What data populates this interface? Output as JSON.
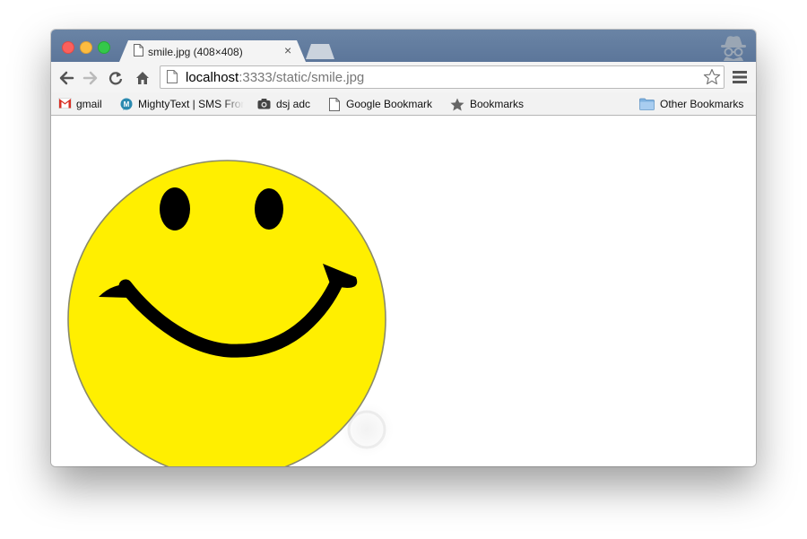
{
  "tab": {
    "title": "smile.jpg (408×408)",
    "close": "×"
  },
  "omnibox": {
    "host": "localhost",
    "path": ":3333/static/smile.jpg"
  },
  "bookmarks": [
    {
      "label": "gmail",
      "icon": "gmail-icon"
    },
    {
      "label": "MightyText | SMS From PC & Tablet",
      "icon": "mightytext-icon"
    },
    {
      "label": "dsj adc",
      "icon": "camera-icon"
    },
    {
      "label": "Google Bookmark",
      "icon": "page-icon"
    },
    {
      "label": "Bookmarks",
      "icon": "star-icon"
    }
  ],
  "other_bookmarks": {
    "label": "Other Bookmarks",
    "icon": "folder-icon"
  },
  "image": {
    "subject": "smiley-face",
    "face_color": "#ffef00",
    "feature_color": "#000000"
  },
  "colors": {
    "titlebar": "#627c9f",
    "toolbar": "#f4f4f4",
    "close": "#fc605c",
    "minimize": "#fdbc40",
    "maximize": "#34c84a"
  }
}
